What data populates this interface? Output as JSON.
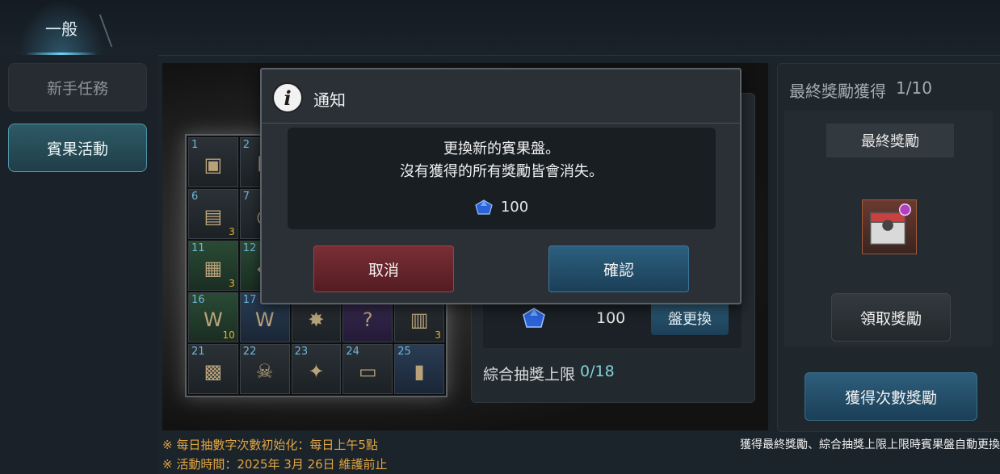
{
  "top_tabs": [
    {
      "label": "一般"
    }
  ],
  "left_nav": [
    {
      "label": "新手任務"
    },
    {
      "label": "賓果活動",
      "selected": true
    }
  ],
  "bingo_grid": {
    "cells": [
      {
        "num": "1",
        "count": "",
        "tone": "normal",
        "glyph": "▣"
      },
      {
        "num": "2",
        "count": "",
        "tone": "normal",
        "glyph": "◘"
      },
      {
        "num": "",
        "count": "",
        "tone": "normal",
        "glyph": ""
      },
      {
        "num": "",
        "count": "",
        "tone": "normal",
        "glyph": ""
      },
      {
        "num": "",
        "count": "",
        "tone": "normal",
        "glyph": ""
      },
      {
        "num": "6",
        "count": "3",
        "tone": "normal",
        "glyph": "▤"
      },
      {
        "num": "7",
        "count": "",
        "tone": "normal",
        "glyph": "◎"
      },
      {
        "num": "",
        "count": "",
        "tone": "normal",
        "glyph": ""
      },
      {
        "num": "",
        "count": "",
        "tone": "normal",
        "glyph": ""
      },
      {
        "num": "",
        "count": "",
        "tone": "normal",
        "glyph": ""
      },
      {
        "num": "11",
        "count": "3",
        "tone": "green",
        "glyph": "▦"
      },
      {
        "num": "12",
        "count": "",
        "tone": "green",
        "glyph": "◆"
      },
      {
        "num": "",
        "count": "",
        "tone": "normal",
        "glyph": ""
      },
      {
        "num": "",
        "count": "",
        "tone": "normal",
        "glyph": ""
      },
      {
        "num": "",
        "count": "",
        "tone": "normal",
        "glyph": ""
      },
      {
        "num": "16",
        "count": "10",
        "tone": "green",
        "glyph": "W"
      },
      {
        "num": "17",
        "count": "",
        "tone": "blue",
        "glyph": "W"
      },
      {
        "num": "",
        "count": "",
        "tone": "normal",
        "glyph": "✸"
      },
      {
        "num": "",
        "count": "",
        "tone": "purple",
        "glyph": "?"
      },
      {
        "num": "",
        "count": "3",
        "tone": "normal",
        "glyph": "▥"
      },
      {
        "num": "21",
        "count": "",
        "tone": "normal",
        "glyph": "▩"
      },
      {
        "num": "22",
        "count": "",
        "tone": "normal",
        "glyph": "☠"
      },
      {
        "num": "23",
        "count": "",
        "tone": "normal",
        "glyph": "✦"
      },
      {
        "num": "24",
        "count": "",
        "tone": "normal",
        "glyph": "▭"
      },
      {
        "num": "25",
        "count": "",
        "tone": "blue",
        "glyph": "▮"
      }
    ]
  },
  "mid_panel": {
    "reset_cost": "100",
    "reset_button": "盤更換",
    "draw_limit_label": "綜合抽獎上限",
    "draw_limit_value": "0/18"
  },
  "right_panel": {
    "title": "最終獎勵獲得",
    "progress": "1/10",
    "final_reward_header": "最終獎勵",
    "claim_button": "領取獎勵",
    "count_reward_button": "獲得次數獎勵"
  },
  "notes": {
    "daily_reset": "※ 每日抽數字次數初始化：每日上午5點",
    "event_period": "※ 活動時間：2025年 3月 26日 維護前止",
    "auto_reset": "獲得最終獎勵、綜合抽獎上限上限時賓果盤自動更換"
  },
  "dialog": {
    "title": "通知",
    "message_line1": "更換新的賓果盤。",
    "message_line2": "沒有獲得的所有獎勵皆會消失。",
    "cost": "100",
    "cancel": "取消",
    "confirm": "確認"
  },
  "icons": {
    "currency": "blue-gem-icon",
    "info": "info-icon"
  },
  "colors": {
    "accent": "#6ccff2",
    "note_orange": "#e0a640",
    "cancel_red": "#7a2e35",
    "confirm_blue": "#2c5f7e"
  }
}
